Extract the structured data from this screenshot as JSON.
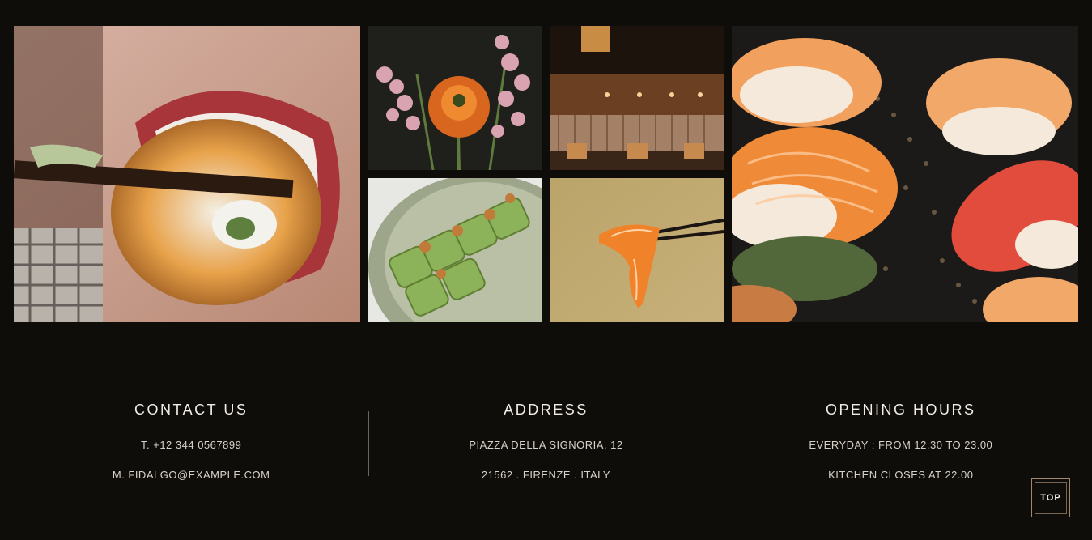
{
  "gallery": {
    "images": [
      {
        "name": "woman-eating-sushi-roll-photo"
      },
      {
        "name": "flowers-photo"
      },
      {
        "name": "restaurant-interior-photo"
      },
      {
        "name": "green-sushi-rolls-photo"
      },
      {
        "name": "salmon-slice-chopsticks-photo"
      },
      {
        "name": "nigiri-sushi-photo"
      }
    ]
  },
  "footer": {
    "contact": {
      "title": "CONTACT US",
      "phone": "T. +12 344 0567899",
      "email": "M. FIDALGO@EXAMPLE.COM"
    },
    "address": {
      "title": "ADDRESS",
      "line1": "PIAZZA DELLA SIGNORIA, 12",
      "line2": "21562 . FIRENZE . ITALY"
    },
    "hours": {
      "title": "OPENING HOURS",
      "line1": "EVERYDAY : FROM 12.30 TO 23.00",
      "line2": "KITCHEN CLOSES AT 22.00"
    }
  },
  "top_button": {
    "label": "TOP"
  },
  "colors": {
    "background": "#0f0d0a",
    "text": "#e9e4dc",
    "accent_border": "#a6866a"
  }
}
